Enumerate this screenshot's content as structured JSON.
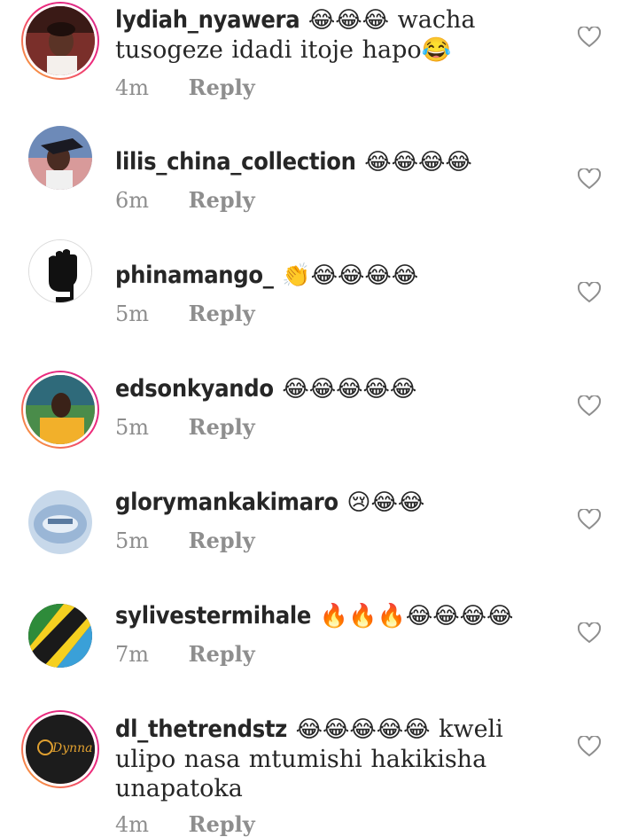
{
  "comments": [
    {
      "username": "lydiah_nyawera",
      "emoji": "😂😂😂",
      "text": " wacha tusogeze idadi itoje hapo😂",
      "time": "4m",
      "reply": "Reply",
      "ring": true
    },
    {
      "username": "lilis_china_collection",
      "emoji": "😂😂😂😂",
      "text": "",
      "time": "6m",
      "reply": "Reply",
      "ring": false
    },
    {
      "username": "phinamango_",
      "emoji": "👏😂😂😂😂",
      "text": "",
      "time": "5m",
      "reply": "Reply",
      "ring": false
    },
    {
      "username": "edsonkyando",
      "emoji": "😂😂😂😂😂",
      "text": "",
      "time": "5m",
      "reply": "Reply",
      "ring": true
    },
    {
      "username": "glorymankakimaro",
      "emoji": "😢😂😂",
      "text": "",
      "time": "5m",
      "reply": "Reply",
      "ring": false
    },
    {
      "username": "sylivestermihale",
      "emoji": "🔥🔥🔥😂😂😂😂",
      "text": "",
      "time": "7m",
      "reply": "Reply",
      "ring": false
    },
    {
      "username": "dl_thetrendstz",
      "emoji": "😂😂😂😂😂",
      "text": " kweli ulipo nasa mtumishi hakikisha unapatoka",
      "time": "4m",
      "reply": "Reply",
      "ring": true
    }
  ],
  "avatar_logo_text": "Dynna Naturalz",
  "colors": {
    "ring_start": "#f9b234",
    "ring_end": "#d52c8a",
    "meta": "#8e8e8e",
    "text": "#262626"
  },
  "icons": {
    "like": "heart-outline-icon"
  }
}
